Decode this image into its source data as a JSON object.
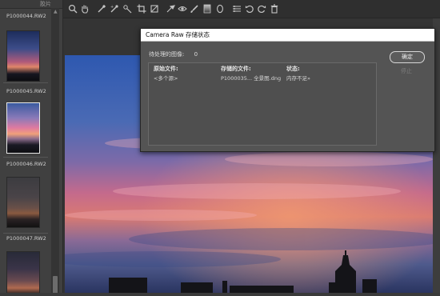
{
  "filmstrip": {
    "header": "胶片",
    "items": [
      {
        "label": "P1000044.RW2"
      },
      {
        "label": "P1000045.RW2"
      },
      {
        "label": "P1000046.RW2"
      },
      {
        "label": "P1000047.RW2"
      }
    ]
  },
  "toolbar": {
    "tools": [
      "zoom-icon",
      "hand-icon",
      "white-balance-icon",
      "color-sampler-icon",
      "targeted-adjustment-icon",
      "crop-icon",
      "straighten-icon",
      "spot-removal-icon",
      "red-eye-icon",
      "adjustment-brush-icon",
      "graduated-filter-icon",
      "radial-filter-icon",
      "preferences-icon",
      "rotate-ccw-icon",
      "rotate-cw-icon",
      "trash-icon"
    ]
  },
  "dialog": {
    "title": "Camera Raw 存储状态",
    "remaining_label": "待处理的图像:",
    "remaining_count": "0",
    "columns": {
      "original": "原始文件:",
      "saved": "存储的文件:",
      "status": "状态:"
    },
    "row": {
      "original": "<多个源>",
      "saved": "P1000035... 全景图.dng",
      "status": "内存不足»"
    },
    "ok_label": "确定",
    "stop_label": "停止"
  },
  "colors": {
    "accent_border": "#d7d7d7",
    "dialog_bg": "#545454",
    "selected_thumb_border": "#e8e8e8"
  }
}
